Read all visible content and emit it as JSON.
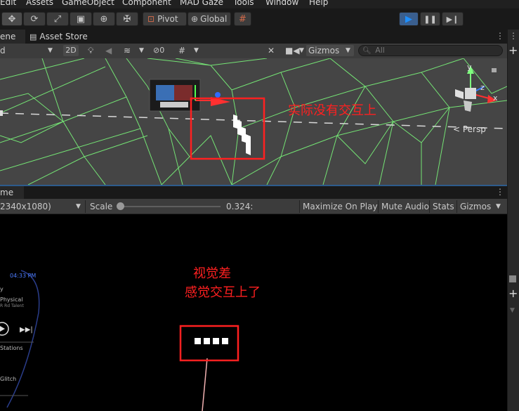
{
  "menu": [
    "Edit",
    "Assets",
    "GameObject",
    "Component",
    "MAD Gaze",
    "Tools",
    "Window",
    "Help"
  ],
  "toolbar": {
    "pivot_label": "Pivot",
    "global_label": "Global"
  },
  "scene_tabs": {
    "scene_label": "ene",
    "asset_store_label": "Asset Store"
  },
  "scene_toolbar": {
    "shading_mode": "d",
    "mode_2d": "2D",
    "gizmos_label": "Gizmos",
    "search_placeholder": "All"
  },
  "scene_view": {
    "annotation": "实际没有交互上",
    "persp_label": "< Persp"
  },
  "game_tabs": {
    "game_label": "me"
  },
  "game_toolbar": {
    "resolution": "2340x1080)",
    "scale_label": "Scale",
    "scale_value": "0.324:",
    "maximize_label": "Maximize On Play",
    "mute_label": "Mute Audio",
    "stats_label": "Stats",
    "gizmos_label": "Gizmos"
  },
  "game_view": {
    "annotation_line1": "视觉差",
    "annotation_line2": "感觉交互上了",
    "hud_time": "04:33 PM",
    "hud_lines": [
      "y",
      "Physical",
      "R Rd Talent",
      "Stations",
      "Glitch"
    ]
  },
  "colors": {
    "accent_blue": "#2d5b8c",
    "annotation_red": "#ff2020",
    "wire_green": "#7dff7d"
  }
}
